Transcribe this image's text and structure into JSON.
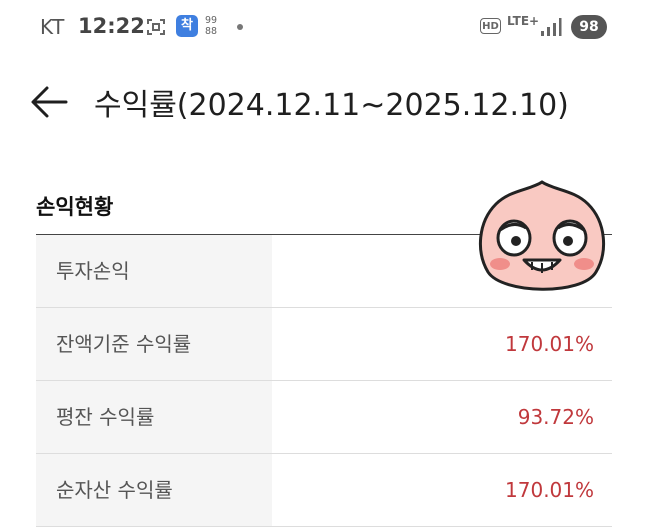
{
  "status_bar": {
    "carrier": "KT",
    "time": "12:22",
    "app_badge": "착",
    "grid_top": "99",
    "grid_bottom": "88",
    "hd": "HD",
    "network": "LTE+",
    "battery": "98"
  },
  "header": {
    "title": "수익률(2024.12.11~2025.12.10)"
  },
  "section": {
    "title": "손익현황",
    "rows": [
      {
        "label": "투자손익",
        "value": ""
      },
      {
        "label": "잔액기준 수익률",
        "value": "170.01%"
      },
      {
        "label": "평잔 수익률",
        "value": "93.72%"
      },
      {
        "label": "순자산 수익률",
        "value": "170.01%"
      }
    ]
  },
  "colors": {
    "positive": "#c0383c",
    "label_bg": "#f5f5f5",
    "sticker_fill": "#f9c9c2"
  },
  "icons": [
    "back-arrow-icon",
    "scan-icon",
    "signal-icon",
    "peach-sticker"
  ]
}
